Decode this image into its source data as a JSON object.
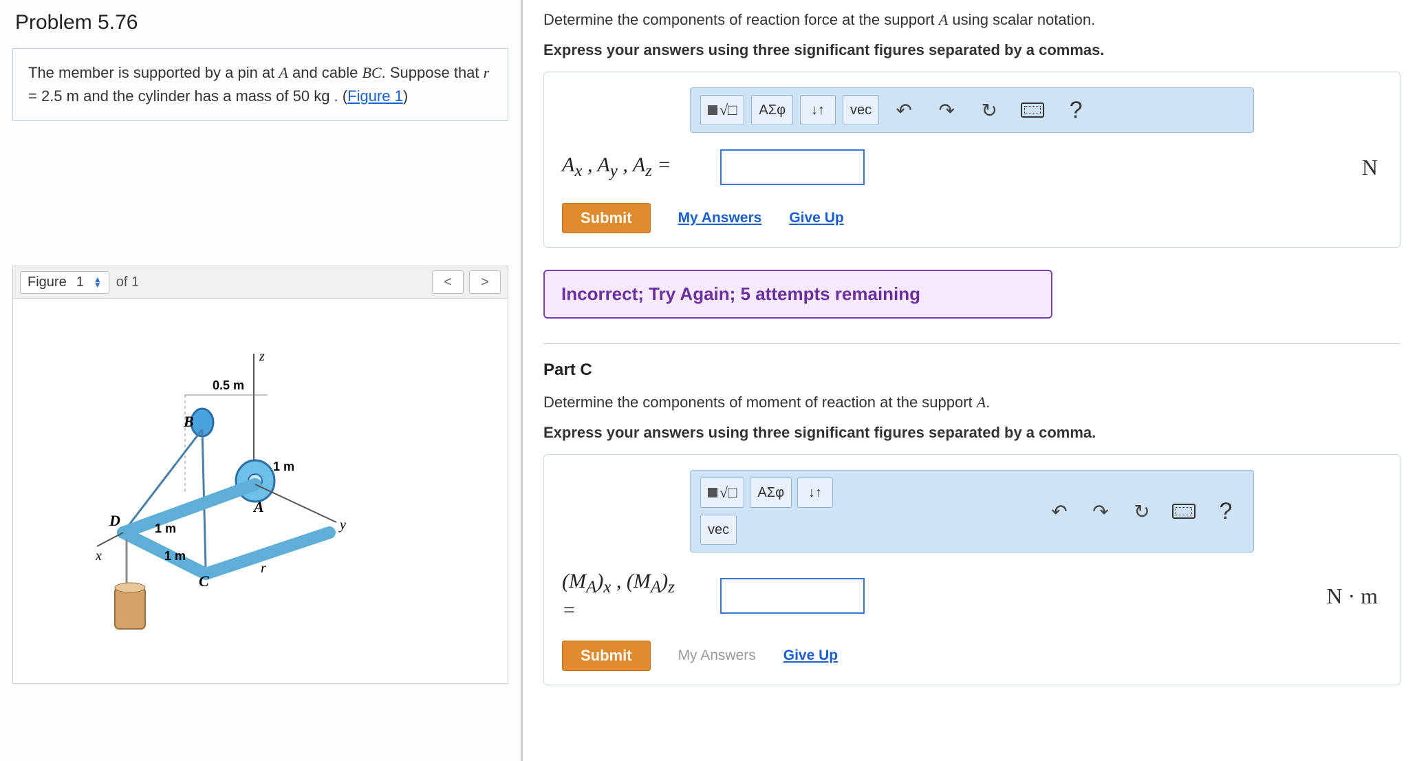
{
  "problem": {
    "title": "Problem 5.76",
    "text1": "The member is supported by a pin at ",
    "pinA": "A",
    "text2": " and cable ",
    "cable": "BC",
    "text3": ". Suppose that ",
    "rvar": "r",
    "req": " = 2.5  m",
    "text4": " and the cylinder has a mass of ",
    "mass": "50  kg",
    "text5": " . (",
    "figlink": "Figure 1",
    "text6": ")"
  },
  "figure": {
    "label": "Figure",
    "current": "1",
    "of_label": "of 1"
  },
  "partB": {
    "instr": "Determine the components of reaction force at the support ",
    "instrA": "A",
    "instr2": " using scalar notation.",
    "instr_bold": "Express your answers using three significant figures separated by a commas.",
    "tools": {
      "greek": "ΑΣφ",
      "vec": "vec",
      "sub": "↓↑"
    },
    "label": "Aₓ , A_y , A_z =",
    "unit": "N",
    "submit": "Submit",
    "myans": "My Answers",
    "giveup": "Give Up",
    "feedback": "Incorrect; Try Again; 5 attempts remaining"
  },
  "partC": {
    "heading": "Part C",
    "instr": "Determine the components of moment of reaction at the support ",
    "instrA": "A",
    "instr2": ".",
    "instr_bold": "Express your answers using three significant figures separated by a comma.",
    "tools": {
      "greek": "ΑΣφ",
      "vec": "vec",
      "sub": "↓↑"
    },
    "label_html": "(M_A)_x , (M_A)_z =",
    "unit": "N · m",
    "submit": "Submit",
    "myans": "My Answers",
    "giveup": "Give Up"
  }
}
